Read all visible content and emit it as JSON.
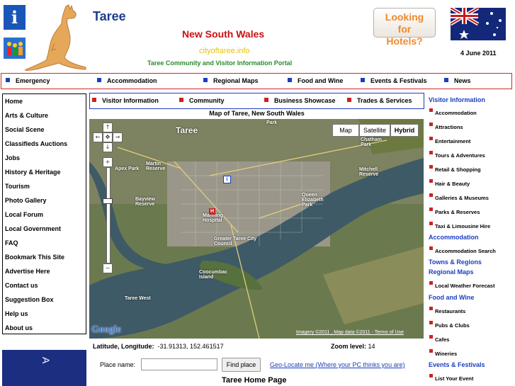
{
  "header": {
    "title": "Taree",
    "state": "New South Wales",
    "domain": "cityoftaree.info",
    "tagline": "Taree Community and Visitor Information Portal",
    "hotels_button": "Looking for Hotels?",
    "date": "4 June 2011",
    "info_icon": "i"
  },
  "top_nav": [
    "Emergency",
    "Accommodation",
    "Regional Maps",
    "Food and Wine",
    "Events & Festivals",
    "News"
  ],
  "left_nav": [
    "Home",
    "Arts & Culture",
    "Social Scene",
    "Classifieds Auctions",
    "Jobs",
    "History & Heritage",
    "Tourism",
    "Photo Gallery",
    "Local Forum",
    "Local Government",
    "FAQ",
    "Bookmark This Site",
    "Advertise Here",
    "Contact us",
    "Suggestion Box",
    "Help us",
    "About us"
  ],
  "sub_nav": [
    "Visitor Information",
    "Community",
    "Business Showcase",
    "Trades & Services"
  ],
  "map": {
    "title": "Map of Taree, New South Wales",
    "types": [
      "Map",
      "Satellite",
      "Hybrid"
    ],
    "selected_type": "Hybrid",
    "place_labels": [
      "Taree",
      "Apex Park",
      "Martin Reserve",
      "Bayview Reserve",
      "Manning Hospital",
      "Greater Taree City Council",
      "Queen Elizabeth Park",
      "Mitchell Reserve",
      "Chatham Park",
      "Coocumbac Island",
      "Taree West",
      "Park"
    ],
    "copyright": "Imagery ©2011 , Map data ©2011 - Terms of Use",
    "google": "Google"
  },
  "location": {
    "latlng_label": "Latitude, Longitude:",
    "latlng_value": "-31.91313, 152.461517",
    "zoom_label": "Zoom level:",
    "zoom_value": "14"
  },
  "search": {
    "place_label": "Place name:",
    "place_value": "",
    "find_button": "Find place",
    "geo_link": "Geo-Locate me (Where your PC thinks you are)"
  },
  "footer_heading": "Taree Home Page",
  "promo_text": "A",
  "right_nav": [
    {
      "type": "heading",
      "text": "Visitor Information"
    },
    {
      "type": "item",
      "text": "Accommodation"
    },
    {
      "type": "item",
      "text": "Attractions"
    },
    {
      "type": "item",
      "text": "Entertainment"
    },
    {
      "type": "item",
      "text": "Tours & Adventures"
    },
    {
      "type": "item",
      "text": "Retail & Shopping"
    },
    {
      "type": "item",
      "text": "Hair & Beauty"
    },
    {
      "type": "item",
      "text": "Galleries & Museums"
    },
    {
      "type": "item",
      "text": "Parks & Reserves"
    },
    {
      "type": "item",
      "text": "Taxi & Limousine Hire"
    },
    {
      "type": "heading",
      "text": "Accommodation"
    },
    {
      "type": "item",
      "text": "Accommodation Search"
    },
    {
      "type": "heading",
      "text": "Towns & Regions"
    },
    {
      "type": "heading",
      "text": "Regional Maps"
    },
    {
      "type": "item",
      "text": "Local Weather Forecast"
    },
    {
      "type": "heading",
      "text": "Food and Wine"
    },
    {
      "type": "item",
      "text": "Restaurants"
    },
    {
      "type": "item",
      "text": "Pubs & Clubs"
    },
    {
      "type": "item",
      "text": "Cafes"
    },
    {
      "type": "item",
      "text": "Wineries"
    },
    {
      "type": "heading",
      "text": "Events & Festivals"
    },
    {
      "type": "item",
      "text": "List Your Event"
    }
  ]
}
